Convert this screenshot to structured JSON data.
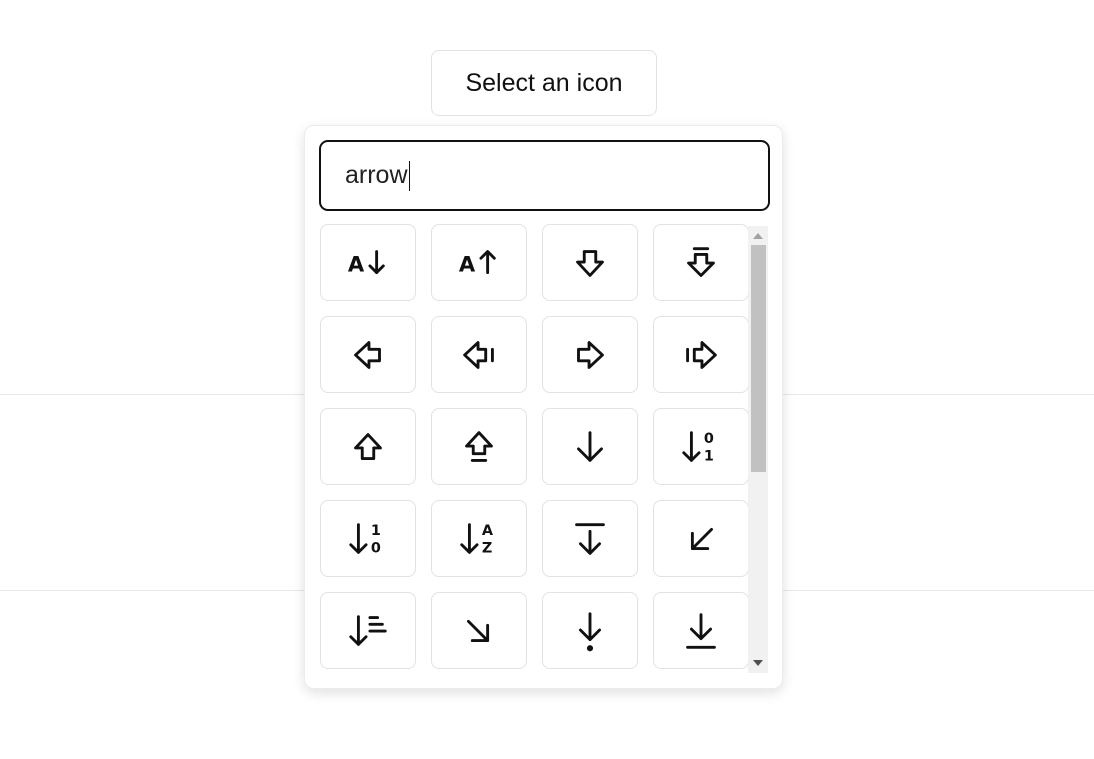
{
  "trigger_label": "Select an icon",
  "search": {
    "value": "arrow"
  },
  "icons": [
    "arrow-down-a-icon",
    "arrow-up-a-icon",
    "arrow-big-down-icon",
    "arrow-big-down-line-icon",
    "arrow-big-left-icon",
    "arrow-big-left-line-icon",
    "arrow-big-right-icon",
    "arrow-big-right-line-icon",
    "arrow-big-up-icon",
    "arrow-big-up-line-icon",
    "arrow-down-icon",
    "arrow-down-0-1-icon",
    "arrow-down-1-0-icon",
    "arrow-down-a-z-icon",
    "arrow-down-from-line-icon",
    "arrow-down-left-icon",
    "arrow-down-wide-narrow-icon",
    "arrow-down-right-icon",
    "arrow-down-to-dot-icon",
    "arrow-down-to-line-icon"
  ],
  "glyphs": {
    "a": "A",
    "zero": "0",
    "one": "1",
    "z": "Z"
  },
  "colors": {
    "icon": "#111111",
    "border": "#e2e2e2",
    "scroll_thumb": "#c1c1c1"
  }
}
